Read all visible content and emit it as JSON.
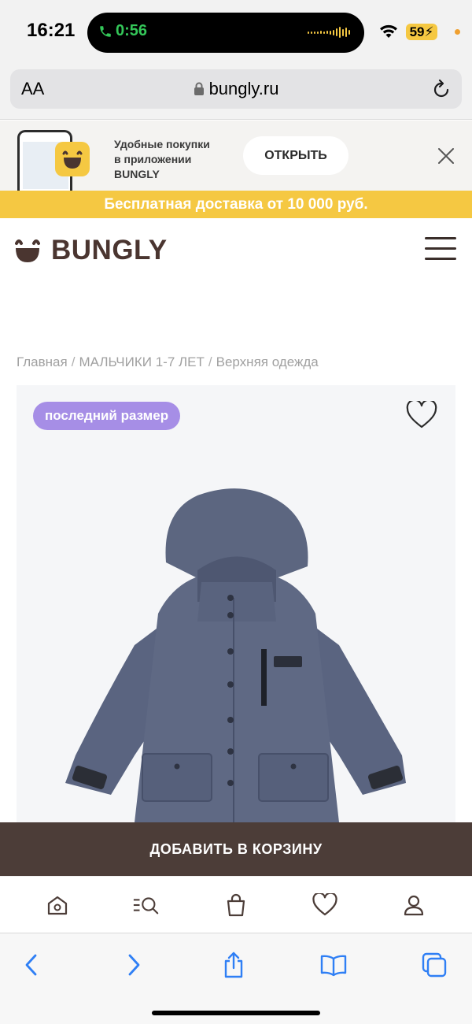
{
  "status": {
    "time": "16:21",
    "call_timer": "0:56",
    "battery": "59"
  },
  "browser": {
    "text_size": "AA",
    "url": "bungly.ru"
  },
  "app_banner": {
    "line1": "Удобные покупки",
    "line2": "в приложении",
    "line3": "BUNGLY",
    "open_label": "ОТКРЫТЬ"
  },
  "promo": {
    "text": "Бесплатная доставка от 10 000 руб."
  },
  "header": {
    "brand": "BUNGLY"
  },
  "breadcrumb": {
    "items": [
      "Главная",
      "МАЛЬЧИКИ 1-7 ЛЕТ",
      "Верхняя одежда"
    ],
    "separator": "/"
  },
  "product": {
    "badge": "последний размер",
    "jacket_color": "#5c6680"
  },
  "cart": {
    "add_label": "ДОБАВИТЬ В КОРЗИНУ"
  },
  "colors": {
    "brand_brown": "#4c3d38",
    "promo_yellow": "#f5c842",
    "badge_purple": "#a68ee6",
    "safari_blue": "#2f7ff5"
  },
  "bottom_nav": {
    "items": [
      "home-icon",
      "catalog-search-icon",
      "bag-icon",
      "heart-icon",
      "profile-icon"
    ]
  },
  "toolbar": {
    "items": [
      "back-icon",
      "forward-icon",
      "share-icon",
      "bookmarks-icon",
      "tabs-icon"
    ]
  }
}
